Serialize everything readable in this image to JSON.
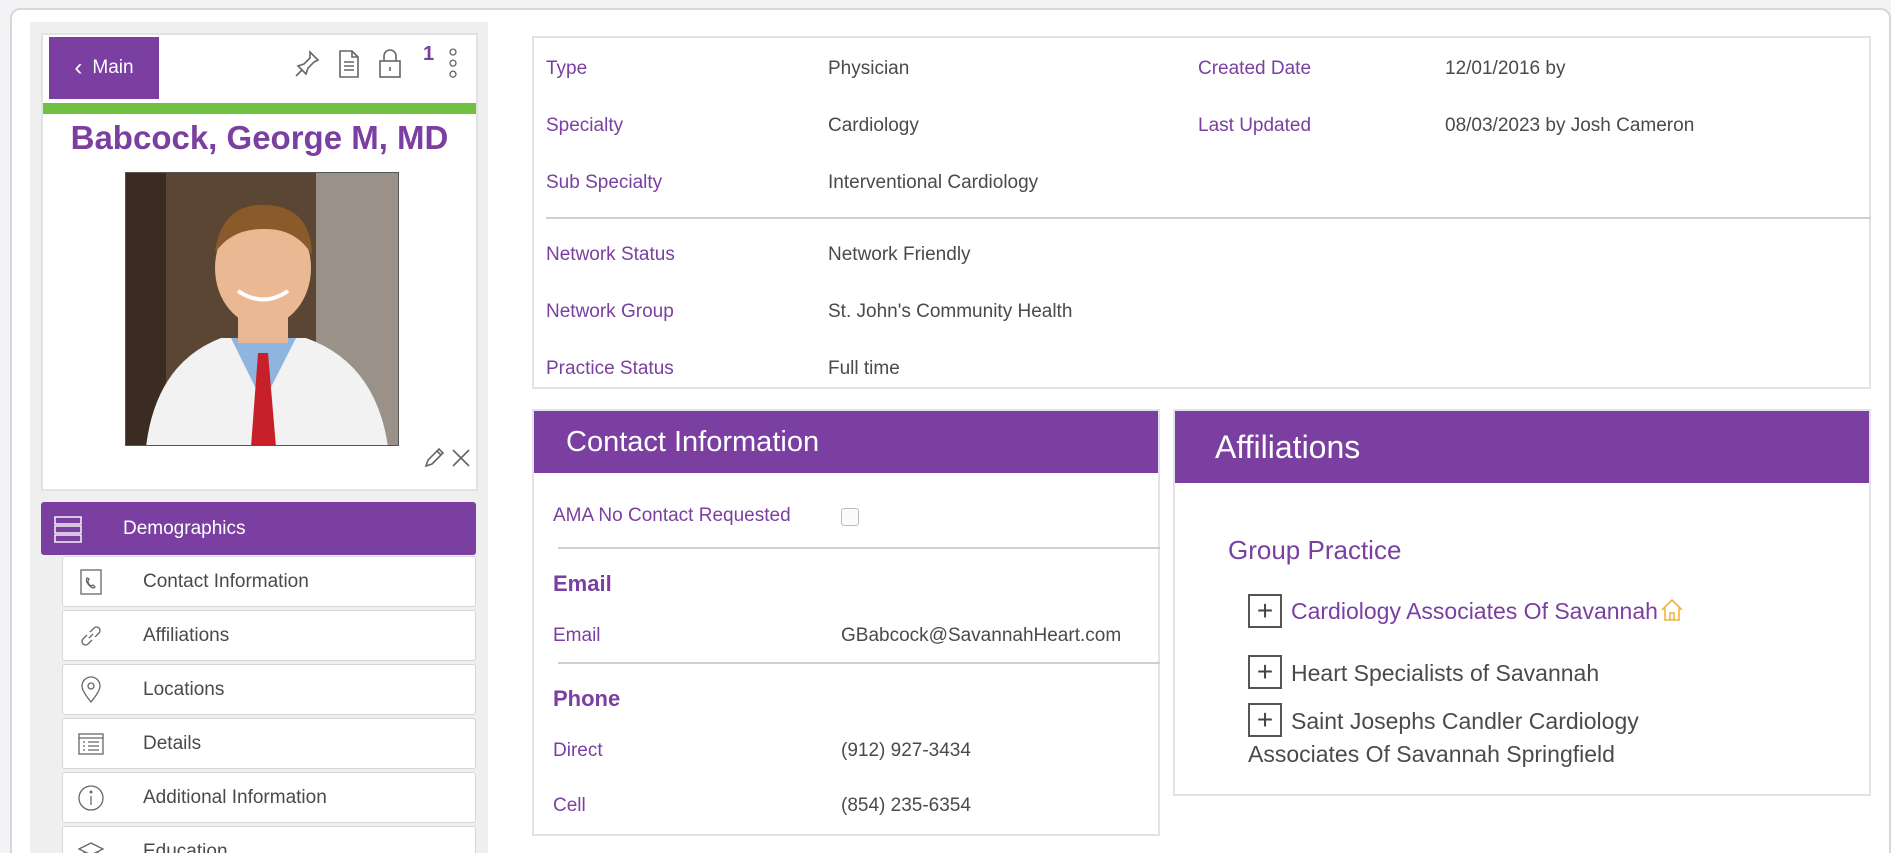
{
  "nav": {
    "back_label": "Main",
    "badge_count": "1"
  },
  "physician": {
    "name": "Babcock, George M, MD"
  },
  "menu": {
    "active": "Demographics",
    "items": [
      "Contact Information",
      "Affiliations",
      "Locations",
      "Details",
      "Additional Information",
      "Education"
    ]
  },
  "details": {
    "type_label": "Type",
    "type_value": "Physician",
    "specialty_label": "Specialty",
    "specialty_value": "Cardiology",
    "subspecialty_label": "Sub Specialty",
    "subspecialty_value": "Interventional Cardiology",
    "created_label": "Created Date",
    "created_value": "12/01/2016 by",
    "updated_label": "Last Updated",
    "updated_value": "08/03/2023 by Josh Cameron",
    "network_status_label": "Network Status",
    "network_status_value": "Network Friendly",
    "network_group_label": "Network Group",
    "network_group_value": "St. John's Community Health",
    "practice_status_label": "Practice Status",
    "practice_status_value": "Full time"
  },
  "contact": {
    "title": "Contact Information",
    "ama_label": "AMA No Contact Requested",
    "email_heading": "Email",
    "email_label": "Email",
    "email_value": "GBabcock@SavannahHeart.com",
    "phone_heading": "Phone",
    "direct_label": "Direct",
    "direct_value": "(912) 927-3434",
    "cell_label": "Cell",
    "cell_value": "(854) 235-6354"
  },
  "affiliations": {
    "title": "Affiliations",
    "group_heading": "Group Practice",
    "items": [
      "Cardiology Associates Of Savannah",
      "Heart Specialists of Savannah",
      "Saint Josephs Candler Cardiology",
      "Associates Of Savannah Springfield"
    ]
  },
  "colors": {
    "accent": "#7a3fa0",
    "status_bar": "#72c041",
    "home_icon": "#f0b43c"
  }
}
